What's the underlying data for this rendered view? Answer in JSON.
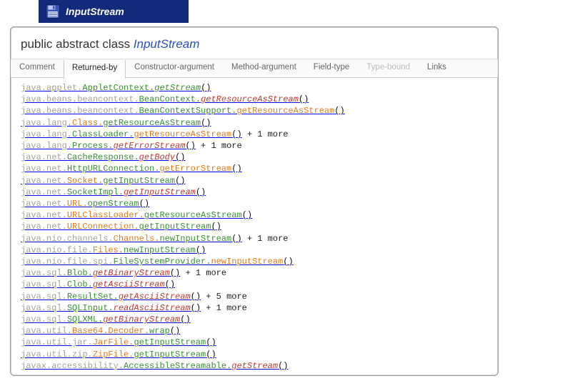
{
  "tab": {
    "title": "InputStream"
  },
  "header": {
    "prefix": "public abstract class ",
    "name": "InputStream"
  },
  "sections": [
    {
      "label": "Comment",
      "state": "normal"
    },
    {
      "label": "Returned-by",
      "state": "active"
    },
    {
      "label": "Constructor-argument",
      "state": "normal"
    },
    {
      "label": "Method-argument",
      "state": "normal"
    },
    {
      "label": "Field-type",
      "state": "normal"
    },
    {
      "label": "Type-bound",
      "state": "disabled"
    },
    {
      "label": "Links",
      "state": "normal"
    }
  ],
  "entries": [
    {
      "segments": [
        {
          "text": "java.applet.",
          "style": "s-dim"
        },
        {
          "text": "AppletContext.",
          "style": "s-green"
        },
        {
          "text": "getStream",
          "style": "s-greenit"
        },
        {
          "text": "()",
          "style": "paren"
        }
      ]
    },
    {
      "segments": [
        {
          "text": "java.beans.beancontext.",
          "style": "s-dim"
        },
        {
          "text": "BeanContext.",
          "style": "s-green"
        },
        {
          "text": "getResourceAsStream",
          "style": "s-red"
        },
        {
          "text": "()",
          "style": "paren"
        }
      ]
    },
    {
      "segments": [
        {
          "text": "java.beans.beancontext.",
          "style": "s-dim"
        },
        {
          "text": "BeanContextSupport.",
          "style": "s-green"
        },
        {
          "text": "getResourceAsStream",
          "style": "s-orange"
        },
        {
          "text": "()",
          "style": "paren"
        }
      ]
    },
    {
      "segments": [
        {
          "text": "java.lang.",
          "style": "s-dim"
        },
        {
          "text": "Class.",
          "style": "s-orange"
        },
        {
          "text": "getResourceAsStream",
          "style": "s-green"
        },
        {
          "text": "()",
          "style": "paren"
        }
      ]
    },
    {
      "segments": [
        {
          "text": "java.lang.",
          "style": "s-dim"
        },
        {
          "text": "ClassLoader.",
          "style": "s-green"
        },
        {
          "text": "getResourceAsStream",
          "style": "s-orange"
        },
        {
          "text": "()",
          "style": "paren"
        }
      ],
      "more": " + 1 more"
    },
    {
      "segments": [
        {
          "text": "java.lang.",
          "style": "s-dim"
        },
        {
          "text": "Process.",
          "style": "s-green"
        },
        {
          "text": "getErrorStream",
          "style": "s-red"
        },
        {
          "text": "()",
          "style": "paren"
        }
      ],
      "more": " + 1 more"
    },
    {
      "segments": [
        {
          "text": "java.net.",
          "style": "s-dim"
        },
        {
          "text": "CacheResponse.",
          "style": "s-green"
        },
        {
          "text": "getBody",
          "style": "s-red"
        },
        {
          "text": "()",
          "style": "paren"
        }
      ]
    },
    {
      "segments": [
        {
          "text": "java.net.",
          "style": "s-dim"
        },
        {
          "text": "HttpURLConnection.",
          "style": "s-green"
        },
        {
          "text": "getErrorStream",
          "style": "s-orange"
        },
        {
          "text": "()",
          "style": "paren"
        }
      ]
    },
    {
      "segments": [
        {
          "text": "java.net.",
          "style": "s-dim"
        },
        {
          "text": "Socket.",
          "style": "s-orange"
        },
        {
          "text": "getInputStream",
          "style": "s-green"
        },
        {
          "text": "()",
          "style": "paren"
        }
      ]
    },
    {
      "segments": [
        {
          "text": "java.net.",
          "style": "s-dim"
        },
        {
          "text": "SocketImpl.",
          "style": "s-green"
        },
        {
          "text": "getInputStream",
          "style": "s-red"
        },
        {
          "text": "()",
          "style": "paren"
        }
      ]
    },
    {
      "segments": [
        {
          "text": "java.net.",
          "style": "s-dim"
        },
        {
          "text": "URL.",
          "style": "s-orange"
        },
        {
          "text": "openStream",
          "style": "s-green"
        },
        {
          "text": "()",
          "style": "paren"
        }
      ]
    },
    {
      "segments": [
        {
          "text": "java.net.",
          "style": "s-dim"
        },
        {
          "text": "URLClassLoader.",
          "style": "s-orange"
        },
        {
          "text": "getResourceAsStream",
          "style": "s-green"
        },
        {
          "text": "()",
          "style": "paren"
        }
      ]
    },
    {
      "segments": [
        {
          "text": "java.net.",
          "style": "s-dim"
        },
        {
          "text": "URLConnection.",
          "style": "s-orange"
        },
        {
          "text": "getInputStream",
          "style": "s-green"
        },
        {
          "text": "()",
          "style": "paren"
        }
      ]
    },
    {
      "segments": [
        {
          "text": "java.nio.channels.",
          "style": "s-dim"
        },
        {
          "text": "Channels.",
          "style": "s-orange"
        },
        {
          "text": "newInputStream",
          "style": "s-green"
        },
        {
          "text": "()",
          "style": "paren"
        }
      ],
      "more": " + 1 more"
    },
    {
      "segments": [
        {
          "text": "java.nio.file.",
          "style": "s-dim"
        },
        {
          "text": "Files.",
          "style": "s-orange"
        },
        {
          "text": "newInputStream",
          "style": "s-green"
        },
        {
          "text": "()",
          "style": "paren"
        }
      ]
    },
    {
      "segments": [
        {
          "text": "java.nio.file.spi.",
          "style": "s-dim"
        },
        {
          "text": "FileSystemProvider.",
          "style": "s-green"
        },
        {
          "text": "newInputStream",
          "style": "s-orange"
        },
        {
          "text": "()",
          "style": "paren"
        }
      ]
    },
    {
      "segments": [
        {
          "text": "java.sql.",
          "style": "s-dim"
        },
        {
          "text": "Blob.",
          "style": "s-green"
        },
        {
          "text": "getBinaryStream",
          "style": "s-red"
        },
        {
          "text": "()",
          "style": "paren"
        }
      ],
      "more": " + 1 more"
    },
    {
      "segments": [
        {
          "text": "java.sql.",
          "style": "s-dim"
        },
        {
          "text": "Clob.",
          "style": "s-green"
        },
        {
          "text": "getAsciiStream",
          "style": "s-red"
        },
        {
          "text": "()",
          "style": "paren"
        }
      ]
    },
    {
      "segments": [
        {
          "text": "java.sql.",
          "style": "s-dim"
        },
        {
          "text": "ResultSet.",
          "style": "s-green"
        },
        {
          "text": "getAsciiStream",
          "style": "s-red"
        },
        {
          "text": "()",
          "style": "paren"
        }
      ],
      "more": " + 5 more"
    },
    {
      "segments": [
        {
          "text": "java.sql.",
          "style": "s-dim"
        },
        {
          "text": "SQLInput.",
          "style": "s-green"
        },
        {
          "text": "readAsciiStream",
          "style": "s-red"
        },
        {
          "text": "()",
          "style": "paren"
        }
      ],
      "more": " + 1 more"
    },
    {
      "segments": [
        {
          "text": "java.sql.",
          "style": "s-dim"
        },
        {
          "text": "SQLXML.",
          "style": "s-green"
        },
        {
          "text": "getBinaryStream",
          "style": "s-red"
        },
        {
          "text": "()",
          "style": "paren"
        }
      ]
    },
    {
      "segments": [
        {
          "text": "java.util.",
          "style": "s-dim"
        },
        {
          "text": "Base64.Decoder.",
          "style": "s-orange"
        },
        {
          "text": "wrap",
          "style": "s-green"
        },
        {
          "text": "()",
          "style": "paren"
        }
      ]
    },
    {
      "segments": [
        {
          "text": "java.util.jar.",
          "style": "s-dim"
        },
        {
          "text": "JarFile.",
          "style": "s-orange"
        },
        {
          "text": "getInputStream",
          "style": "s-green"
        },
        {
          "text": "()",
          "style": "paren"
        }
      ]
    },
    {
      "segments": [
        {
          "text": "java.util.zip.",
          "style": "s-dim"
        },
        {
          "text": "ZipFile.",
          "style": "s-orange"
        },
        {
          "text": "getInputStream",
          "style": "s-green"
        },
        {
          "text": "()",
          "style": "paren"
        }
      ]
    },
    {
      "segments": [
        {
          "text": "javax.accessibility.",
          "style": "s-dim"
        },
        {
          "text": "AccessibleStreamable.",
          "style": "s-green"
        },
        {
          "text": "getStream",
          "style": "s-red"
        },
        {
          "text": "()",
          "style": "paren"
        }
      ]
    }
  ]
}
